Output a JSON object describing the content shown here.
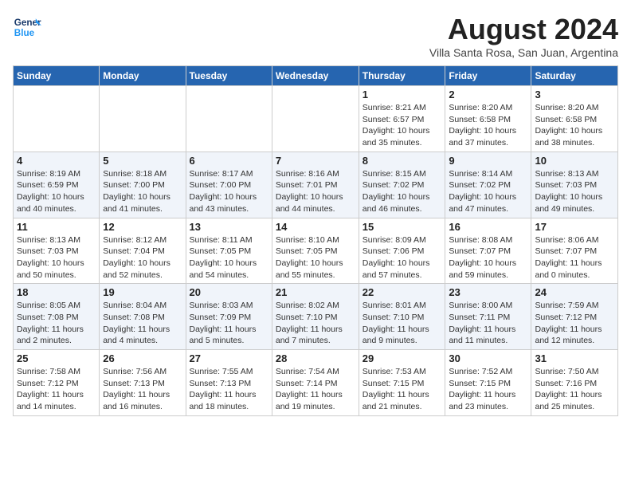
{
  "logo": {
    "line1": "General",
    "line2": "Blue"
  },
  "title": "August 2024",
  "location": "Villa Santa Rosa, San Juan, Argentina",
  "days_of_week": [
    "Sunday",
    "Monday",
    "Tuesday",
    "Wednesday",
    "Thursday",
    "Friday",
    "Saturday"
  ],
  "weeks": [
    [
      {
        "day": "",
        "info": ""
      },
      {
        "day": "",
        "info": ""
      },
      {
        "day": "",
        "info": ""
      },
      {
        "day": "",
        "info": ""
      },
      {
        "day": "1",
        "info": "Sunrise: 8:21 AM\nSunset: 6:57 PM\nDaylight: 10 hours\nand 35 minutes."
      },
      {
        "day": "2",
        "info": "Sunrise: 8:20 AM\nSunset: 6:58 PM\nDaylight: 10 hours\nand 37 minutes."
      },
      {
        "day": "3",
        "info": "Sunrise: 8:20 AM\nSunset: 6:58 PM\nDaylight: 10 hours\nand 38 minutes."
      }
    ],
    [
      {
        "day": "4",
        "info": "Sunrise: 8:19 AM\nSunset: 6:59 PM\nDaylight: 10 hours\nand 40 minutes."
      },
      {
        "day": "5",
        "info": "Sunrise: 8:18 AM\nSunset: 7:00 PM\nDaylight: 10 hours\nand 41 minutes."
      },
      {
        "day": "6",
        "info": "Sunrise: 8:17 AM\nSunset: 7:00 PM\nDaylight: 10 hours\nand 43 minutes."
      },
      {
        "day": "7",
        "info": "Sunrise: 8:16 AM\nSunset: 7:01 PM\nDaylight: 10 hours\nand 44 minutes."
      },
      {
        "day": "8",
        "info": "Sunrise: 8:15 AM\nSunset: 7:02 PM\nDaylight: 10 hours\nand 46 minutes."
      },
      {
        "day": "9",
        "info": "Sunrise: 8:14 AM\nSunset: 7:02 PM\nDaylight: 10 hours\nand 47 minutes."
      },
      {
        "day": "10",
        "info": "Sunrise: 8:13 AM\nSunset: 7:03 PM\nDaylight: 10 hours\nand 49 minutes."
      }
    ],
    [
      {
        "day": "11",
        "info": "Sunrise: 8:13 AM\nSunset: 7:03 PM\nDaylight: 10 hours\nand 50 minutes."
      },
      {
        "day": "12",
        "info": "Sunrise: 8:12 AM\nSunset: 7:04 PM\nDaylight: 10 hours\nand 52 minutes."
      },
      {
        "day": "13",
        "info": "Sunrise: 8:11 AM\nSunset: 7:05 PM\nDaylight: 10 hours\nand 54 minutes."
      },
      {
        "day": "14",
        "info": "Sunrise: 8:10 AM\nSunset: 7:05 PM\nDaylight: 10 hours\nand 55 minutes."
      },
      {
        "day": "15",
        "info": "Sunrise: 8:09 AM\nSunset: 7:06 PM\nDaylight: 10 hours\nand 57 minutes."
      },
      {
        "day": "16",
        "info": "Sunrise: 8:08 AM\nSunset: 7:07 PM\nDaylight: 10 hours\nand 59 minutes."
      },
      {
        "day": "17",
        "info": "Sunrise: 8:06 AM\nSunset: 7:07 PM\nDaylight: 11 hours\nand 0 minutes."
      }
    ],
    [
      {
        "day": "18",
        "info": "Sunrise: 8:05 AM\nSunset: 7:08 PM\nDaylight: 11 hours\nand 2 minutes."
      },
      {
        "day": "19",
        "info": "Sunrise: 8:04 AM\nSunset: 7:08 PM\nDaylight: 11 hours\nand 4 minutes."
      },
      {
        "day": "20",
        "info": "Sunrise: 8:03 AM\nSunset: 7:09 PM\nDaylight: 11 hours\nand 5 minutes."
      },
      {
        "day": "21",
        "info": "Sunrise: 8:02 AM\nSunset: 7:10 PM\nDaylight: 11 hours\nand 7 minutes."
      },
      {
        "day": "22",
        "info": "Sunrise: 8:01 AM\nSunset: 7:10 PM\nDaylight: 11 hours\nand 9 minutes."
      },
      {
        "day": "23",
        "info": "Sunrise: 8:00 AM\nSunset: 7:11 PM\nDaylight: 11 hours\nand 11 minutes."
      },
      {
        "day": "24",
        "info": "Sunrise: 7:59 AM\nSunset: 7:12 PM\nDaylight: 11 hours\nand 12 minutes."
      }
    ],
    [
      {
        "day": "25",
        "info": "Sunrise: 7:58 AM\nSunset: 7:12 PM\nDaylight: 11 hours\nand 14 minutes."
      },
      {
        "day": "26",
        "info": "Sunrise: 7:56 AM\nSunset: 7:13 PM\nDaylight: 11 hours\nand 16 minutes."
      },
      {
        "day": "27",
        "info": "Sunrise: 7:55 AM\nSunset: 7:13 PM\nDaylight: 11 hours\nand 18 minutes."
      },
      {
        "day": "28",
        "info": "Sunrise: 7:54 AM\nSunset: 7:14 PM\nDaylight: 11 hours\nand 19 minutes."
      },
      {
        "day": "29",
        "info": "Sunrise: 7:53 AM\nSunset: 7:15 PM\nDaylight: 11 hours\nand 21 minutes."
      },
      {
        "day": "30",
        "info": "Sunrise: 7:52 AM\nSunset: 7:15 PM\nDaylight: 11 hours\nand 23 minutes."
      },
      {
        "day": "31",
        "info": "Sunrise: 7:50 AM\nSunset: 7:16 PM\nDaylight: 11 hours\nand 25 minutes."
      }
    ]
  ]
}
